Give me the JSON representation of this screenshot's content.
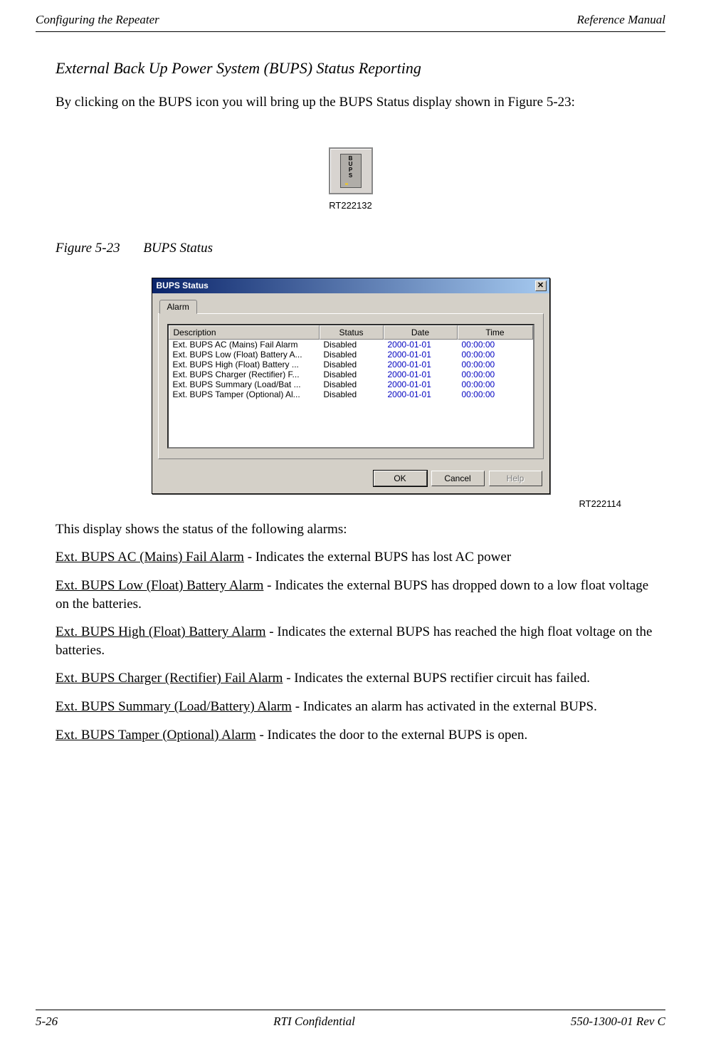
{
  "header": {
    "left": "Configuring the Repeater",
    "right": "Reference Manual"
  },
  "section_heading": "External Back Up Power System (BUPS) Status Reporting",
  "intro_para": "By clicking on the BUPS icon you will bring up the BUPS Status display shown in Figure 5-23:",
  "bups_letters": [
    "B",
    "U",
    "P",
    "S"
  ],
  "icon_ref": "RT222132",
  "figure": {
    "num": "Figure 5-23",
    "title": "BUPS Status"
  },
  "dialog": {
    "title": "BUPS Status",
    "tab": "Alarm",
    "columns": {
      "desc": "Description",
      "status": "Status",
      "date": "Date",
      "time": "Time"
    },
    "rows": [
      {
        "desc": "Ext. BUPS AC (Mains) Fail Alarm",
        "status": "Disabled",
        "date": "2000-01-01",
        "time": "00:00:00"
      },
      {
        "desc": "Ext. BUPS Low (Float) Battery A...",
        "status": "Disabled",
        "date": "2000-01-01",
        "time": "00:00:00"
      },
      {
        "desc": "Ext. BUPS High (Float) Battery ...",
        "status": "Disabled",
        "date": "2000-01-01",
        "time": "00:00:00"
      },
      {
        "desc": "Ext. BUPS Charger (Rectifier) F...",
        "status": "Disabled",
        "date": "2000-01-01",
        "time": "00:00:00"
      },
      {
        "desc": "Ext. BUPS Summary (Load/Bat ...",
        "status": "Disabled",
        "date": "2000-01-01",
        "time": "00:00:00"
      },
      {
        "desc": "Ext. BUPS Tamper (Optional) Al...",
        "status": "Disabled",
        "date": "2000-01-01",
        "time": "00:00:00"
      }
    ],
    "buttons": {
      "ok": "OK",
      "cancel": "Cancel",
      "help": "Help"
    }
  },
  "dialog_ref": "RT222114",
  "body": {
    "intro2": "This display shows the status of the following alarms:",
    "alarms": [
      {
        "name": "Ext. BUPS AC (Mains) Fail Alarm",
        "desc": " - Indicates the external BUPS has lost AC power"
      },
      {
        "name": "Ext. BUPS Low (Float) Battery Alarm",
        "desc": " - Indicates the external BUPS has dropped down to a low float voltage on the batteries."
      },
      {
        "name": "Ext. BUPS High (Float) Battery Alarm",
        "desc": " - Indicates the external BUPS has reached the high float voltage on the batteries."
      },
      {
        "name": "Ext. BUPS Charger (Rectifier) Fail Alarm",
        "desc": " - Indicates the external BUPS rectifier circuit has failed."
      },
      {
        "name": "Ext. BUPS Summary (Load/Battery) Alarm",
        "desc": " - Indicates an alarm has activated in the external BUPS."
      },
      {
        "name": "Ext. BUPS Tamper (Optional) Alarm",
        "desc": " - Indicates the door to the external BUPS is open."
      }
    ]
  },
  "footer": {
    "left": "5-26",
    "center": "RTI Confidential",
    "right": "550-1300-01 Rev C"
  }
}
